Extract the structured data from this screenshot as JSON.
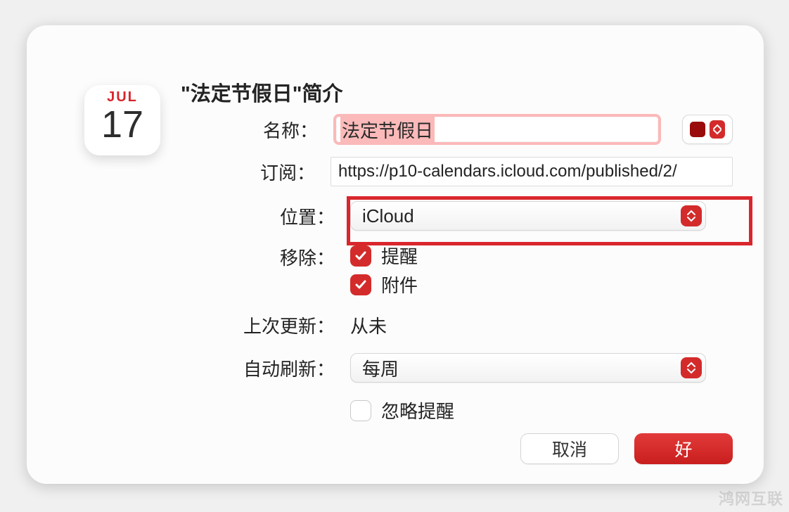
{
  "icon": {
    "month": "JUL",
    "day": "17"
  },
  "title": "\"法定节假日\"简介",
  "labels": {
    "name": "名称：",
    "subscribe": "订阅：",
    "location": "位置：",
    "remove": "移除：",
    "lastUpdate": "上次更新：",
    "autoRefresh": "自动刷新："
  },
  "fields": {
    "name": "法定节假日",
    "subscribeUrl": "https://p10-calendars.icloud.com/published/2/",
    "location": "iCloud",
    "autoRefresh": "每周",
    "lastUpdate": "从未"
  },
  "colorPicker": {
    "swatch": "#9a0b0b"
  },
  "remove": {
    "reminders": {
      "label": "提醒",
      "checked": true
    },
    "attachments": {
      "label": "附件",
      "checked": true
    }
  },
  "ignoreAlerts": {
    "label": "忽略提醒",
    "checked": false
  },
  "buttons": {
    "cancel": "取消",
    "ok": "好"
  },
  "watermark": "鸿网互联"
}
